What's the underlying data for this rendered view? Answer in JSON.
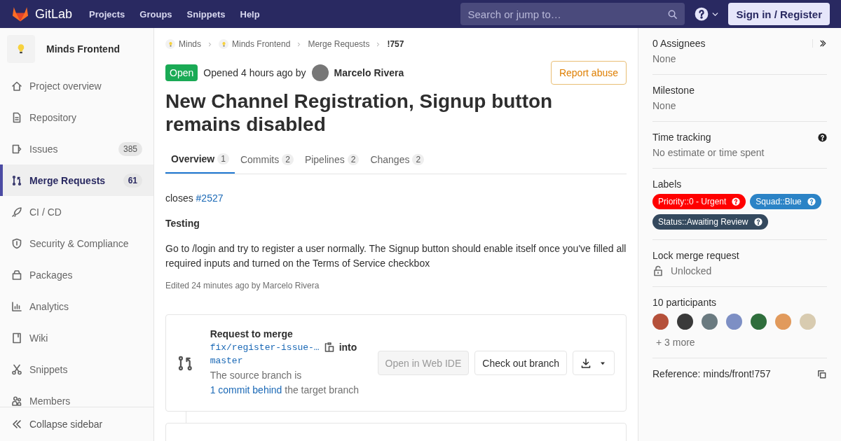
{
  "header": {
    "brand": "GitLab",
    "nav": [
      "Projects",
      "Groups",
      "Snippets",
      "Help"
    ],
    "search": {
      "placeholder": "Search or jump to…"
    },
    "sign_in": "Sign in / Register"
  },
  "sidebar": {
    "project": "Minds Frontend",
    "items": [
      {
        "label": "Project overview",
        "kind": "home",
        "selected": false
      },
      {
        "label": "Repository",
        "kind": "doc",
        "selected": false
      },
      {
        "label": "Issues",
        "kind": "issue",
        "count": "385",
        "selected": false
      },
      {
        "label": "Merge Requests",
        "kind": "merge",
        "count": "61",
        "selected": true
      },
      {
        "label": "CI / CD",
        "kind": "rocket",
        "selected": false
      },
      {
        "label": "Security & Compliance",
        "kind": "shield",
        "selected": false
      },
      {
        "label": "Packages",
        "kind": "package",
        "selected": false
      },
      {
        "label": "Analytics",
        "kind": "chart",
        "selected": false
      },
      {
        "label": "Wiki",
        "kind": "book",
        "selected": false
      },
      {
        "label": "Snippets",
        "kind": "scissors",
        "selected": false
      },
      {
        "label": "Members",
        "kind": "users",
        "selected": false
      }
    ],
    "collapse": "Collapse sidebar"
  },
  "breadcrumbs": [
    {
      "label": "Minds",
      "avatar": true
    },
    {
      "label": "Minds Frontend",
      "avatar": true
    },
    {
      "label": "Merge Requests",
      "avatar": false
    },
    {
      "label": "!757",
      "avatar": false
    }
  ],
  "merge_request": {
    "status": "Open",
    "opened": "Opened 4 hours ago by",
    "author": "Marcelo Rivera",
    "report": "Report abuse",
    "title": "New Channel Registration, Signup button remains disabled"
  },
  "tabs": [
    {
      "label": "Overview",
      "count": "1",
      "selected": true
    },
    {
      "label": "Commits",
      "count": "2",
      "selected": false
    },
    {
      "label": "Pipelines",
      "count": "2",
      "selected": false
    },
    {
      "label": "Changes",
      "count": "2",
      "selected": false
    }
  ],
  "description": {
    "closes": "closes",
    "issue_link": "#2527",
    "heading": "Testing",
    "paragraph": "Go to /login and try to register a user normally. The Signup button should enable itself once you've filled all required inputs and turned on the Terms of Service checkbox",
    "edited": "Edited 24 minutes ago by Marcelo Rivera"
  },
  "merge_widget": {
    "title": "Request to merge",
    "source_branch": "fix/register-issue-…",
    "into": "into",
    "target_branch": "master",
    "status_before": "The source branch is",
    "status_link": "1 commit behind",
    "status_after": "the target branch",
    "buttons": [
      {
        "label": "Open in Web IDE",
        "disabled": true
      },
      {
        "label": "Check out branch",
        "disabled": false
      }
    ]
  },
  "right_sidebar": {
    "assignees": {
      "title": "0 Assignees",
      "value": "None"
    },
    "milestone": {
      "title": "Milestone",
      "value": "None"
    },
    "time_tracking": {
      "title": "Time tracking",
      "value": "No estimate or time spent"
    },
    "labels": {
      "title": "Labels",
      "items": [
        {
          "text": "Priority::0 - Urgent",
          "color": "#ff0000"
        },
        {
          "text": "Squad::Blue",
          "color": "#2b83c6"
        },
        {
          "text": "Status::Awaiting Review",
          "color": "#34495e"
        }
      ]
    },
    "lock": {
      "title": "Lock merge request",
      "value": "Unlocked"
    },
    "participants": {
      "title": "10 participants",
      "avatars": [
        {
          "color": "#b5503a"
        },
        {
          "color": "#3a3a3a"
        },
        {
          "color": "#6a7a80"
        },
        {
          "color": "#7d8fc4"
        },
        {
          "color": "#2f6e3c"
        },
        {
          "color": "#e19a5c"
        },
        {
          "color": "#d8cbb0"
        }
      ],
      "more": "+ 3 more"
    },
    "reference": "Reference: minds/front!757"
  }
}
